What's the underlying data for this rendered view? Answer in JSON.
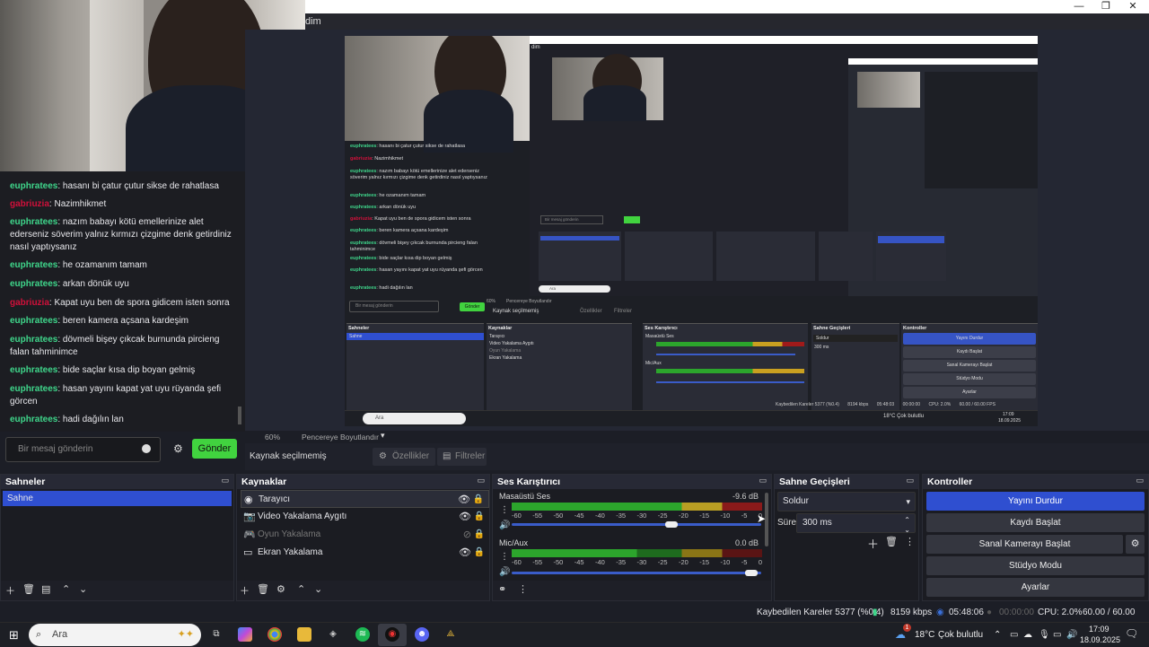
{
  "window": {
    "title": "dim",
    "controls": [
      "—",
      "❐",
      "✕"
    ]
  },
  "chat": {
    "messages": [
      {
        "user": "euphratees",
        "user_type": "e",
        "text": "hasanı bi çatur çutur sikse de rahatlasa"
      },
      {
        "user": "gabriuzia",
        "user_type": "g",
        "text": "Nazimhikmet"
      },
      {
        "user": "euphratees",
        "user_type": "e",
        "text": "nazım babayı kötü emellerinize alet ederseniz söverim yalnız kırmızı çizgime denk getirdiniz nasıl yaptıysanız"
      },
      {
        "user": "euphratees",
        "user_type": "e",
        "text": "he ozamanım tamam"
      },
      {
        "user": "euphratees",
        "user_type": "e",
        "text": "arkan dönük uyu"
      },
      {
        "user": "gabriuzia",
        "user_type": "g",
        "text": "Kapat uyu ben de spora gidicem isten sonra"
      },
      {
        "user": "euphratees",
        "user_type": "e",
        "text": "beren kamera açsana kardeşim"
      },
      {
        "user": "euphratees",
        "user_type": "e",
        "text": "dövmeli bişey çıkcak burnunda pircieng falan tahminimce"
      },
      {
        "user": "euphratees",
        "user_type": "e",
        "text": "bide saçlar kısa dip boyan gelmiş"
      },
      {
        "user": "euphratees",
        "user_type": "e",
        "text": "hasan yayını kapat yat uyu rüyanda şefi görcen"
      },
      {
        "user": "euphratees",
        "user_type": "e",
        "text": "hadi dağılın lan"
      }
    ],
    "input_placeholder": "Bir mesaj gönderin",
    "send_label": "Gönder"
  },
  "preview": {
    "zoom": "60%",
    "zoom_mode": "Pencereye Boyutlandır",
    "nested_search": "Ara",
    "nested_time": "17:09",
    "nested_date": "18.09.2025",
    "nested_status": "Kaybedilen Kareler 5377 (%0.4)",
    "nested_kbps": "8194 kbps",
    "nested_live": "05:48:03",
    "nested_rec": "00:00:00",
    "nested_cpu": "CPU: 2.0%",
    "nested_fps": "60.00 / 60.00 FPS",
    "nested_weather": "18°C Çok bulutlu"
  },
  "source_bar": {
    "no_source": "Kaynak seçilmemiş",
    "properties": "Özellikler",
    "filters": "Filtreler"
  },
  "scenes": {
    "title": "Sahneler",
    "items": [
      "Sahne"
    ]
  },
  "sources": {
    "title": "Kaynaklar",
    "items": [
      {
        "label": "Tarayıcı",
        "icon": "globe-icon",
        "visible": true
      },
      {
        "label": "Video Yakalama Aygıtı",
        "icon": "camera-icon",
        "visible": true
      },
      {
        "label": "Oyun Yakalama",
        "icon": "gamepad-icon",
        "visible": false
      },
      {
        "label": "Ekran Yakalama",
        "icon": "monitor-icon",
        "visible": true
      }
    ]
  },
  "mixer": {
    "title": "Ses Karıştırıcı",
    "channels": [
      {
        "name": "Masaüstü Ses",
        "db": "-9.6 dB",
        "volume": 0.64
      },
      {
        "name": "Mic/Aux",
        "db": "0.0 dB",
        "volume": 0.96
      }
    ],
    "scale": [
      "-60",
      "-55",
      "-50",
      "-45",
      "-40",
      "-35",
      "-30",
      "-25",
      "-20",
      "-15",
      "-10",
      "-5",
      "0"
    ]
  },
  "transitions": {
    "title": "Sahne Geçişleri",
    "selected": "Soldur",
    "duration_label": "Süre",
    "duration_value": "300 ms"
  },
  "controls": {
    "title": "Kontroller",
    "buttons": [
      "Yayını Durdur",
      "Kaydı Başlat",
      "Sanal Kamerayı Başlat",
      "Stüdyo Modu",
      "Ayarlar"
    ]
  },
  "status": {
    "dropped": "Kaybedilen Kareler 5377 (%0.4)",
    "kbps": "8159 kbps",
    "live_time": "05:48:06",
    "rec_time": "00:00:00",
    "cpu": "CPU: 2.0%",
    "fps": "60.00 / 60.00 FPS"
  },
  "taskbar": {
    "search": "Ara",
    "weather": "18°C",
    "weather_desc": "Çok bulutlu",
    "time": "17:09",
    "date": "18.09.2025",
    "badge": "1"
  },
  "colors": {
    "accent": "#2f4fd0",
    "send_green": "#41d33f",
    "chat_user_green": "#3fd68b",
    "chat_user_red": "#d0103a"
  }
}
